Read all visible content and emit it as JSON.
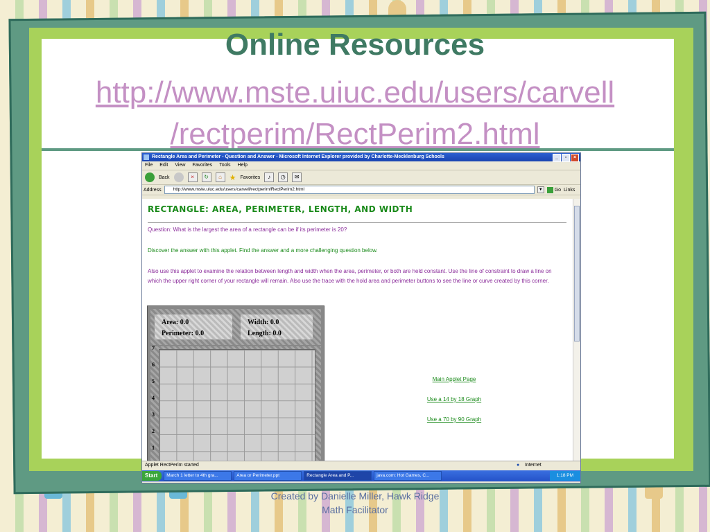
{
  "slide": {
    "title": "Online Resources",
    "url_line1": "http://www.mste.uiuc.edu/users/carvell",
    "url_line2": "/rectperim/RectPerim2.html",
    "footer_line1": "Created by Danielle Miller, Hawk Ridge",
    "footer_line2": "Math Facilitator"
  },
  "browser": {
    "window_title": "Rectangle Area and Perimeter - Question and Answer - Microsoft Internet Explorer provided by Charlotte-Mecklenburg Schools",
    "menu": [
      "File",
      "Edit",
      "View",
      "Favorites",
      "Tools",
      "Help"
    ],
    "toolbar": {
      "back": "Back",
      "favorites": "Favorites"
    },
    "address_label": "Address",
    "address_value": "http://www.mste.uiuc.edu/users/carvell/rectperim/RectPerim2.html",
    "go": "Go",
    "links": "Links",
    "status_text": "Applet RectPerim started",
    "status_zone": "Internet",
    "taskbar": {
      "start": "Start",
      "tasks": [
        "March 1 letter to 4th gra...",
        "Area or Perimeter.ppt",
        "Rectangle Area and P...",
        "java.com: Hot Games, C..."
      ],
      "clock": "1:18 PM"
    }
  },
  "page": {
    "heading": "RECTANGLE: AREA, PERIMETER, LENGTH, AND WIDTH",
    "question": "Question: What is the largest the area of a rectangle can be if its perimeter is 20?",
    "discover": "Discover the answer with this applet. Find the answer and a more challenging question below.",
    "also": "Also use this applet to examine the relation between length and width when the area, perimeter, or both are held constant. Use the line of constraint to draw a line on which the upper right corner of your rectangle will remain. Also use the trace with the hold area and perimeter buttons to see the line or curve created by this corner.",
    "applet": {
      "area": "Area: 0.0",
      "perimeter": "Perimeter: 0.0",
      "width": "Width: 0.0",
      "length": "Length: 0.0",
      "y_labels": [
        "7",
        "6",
        "5",
        "4",
        "3",
        "2",
        "1"
      ]
    },
    "link_main": "Main Applet Page",
    "link_14x18": "Use a 14 by 18 Graph",
    "link_70x90": "Use a 70 by 90 Graph"
  }
}
